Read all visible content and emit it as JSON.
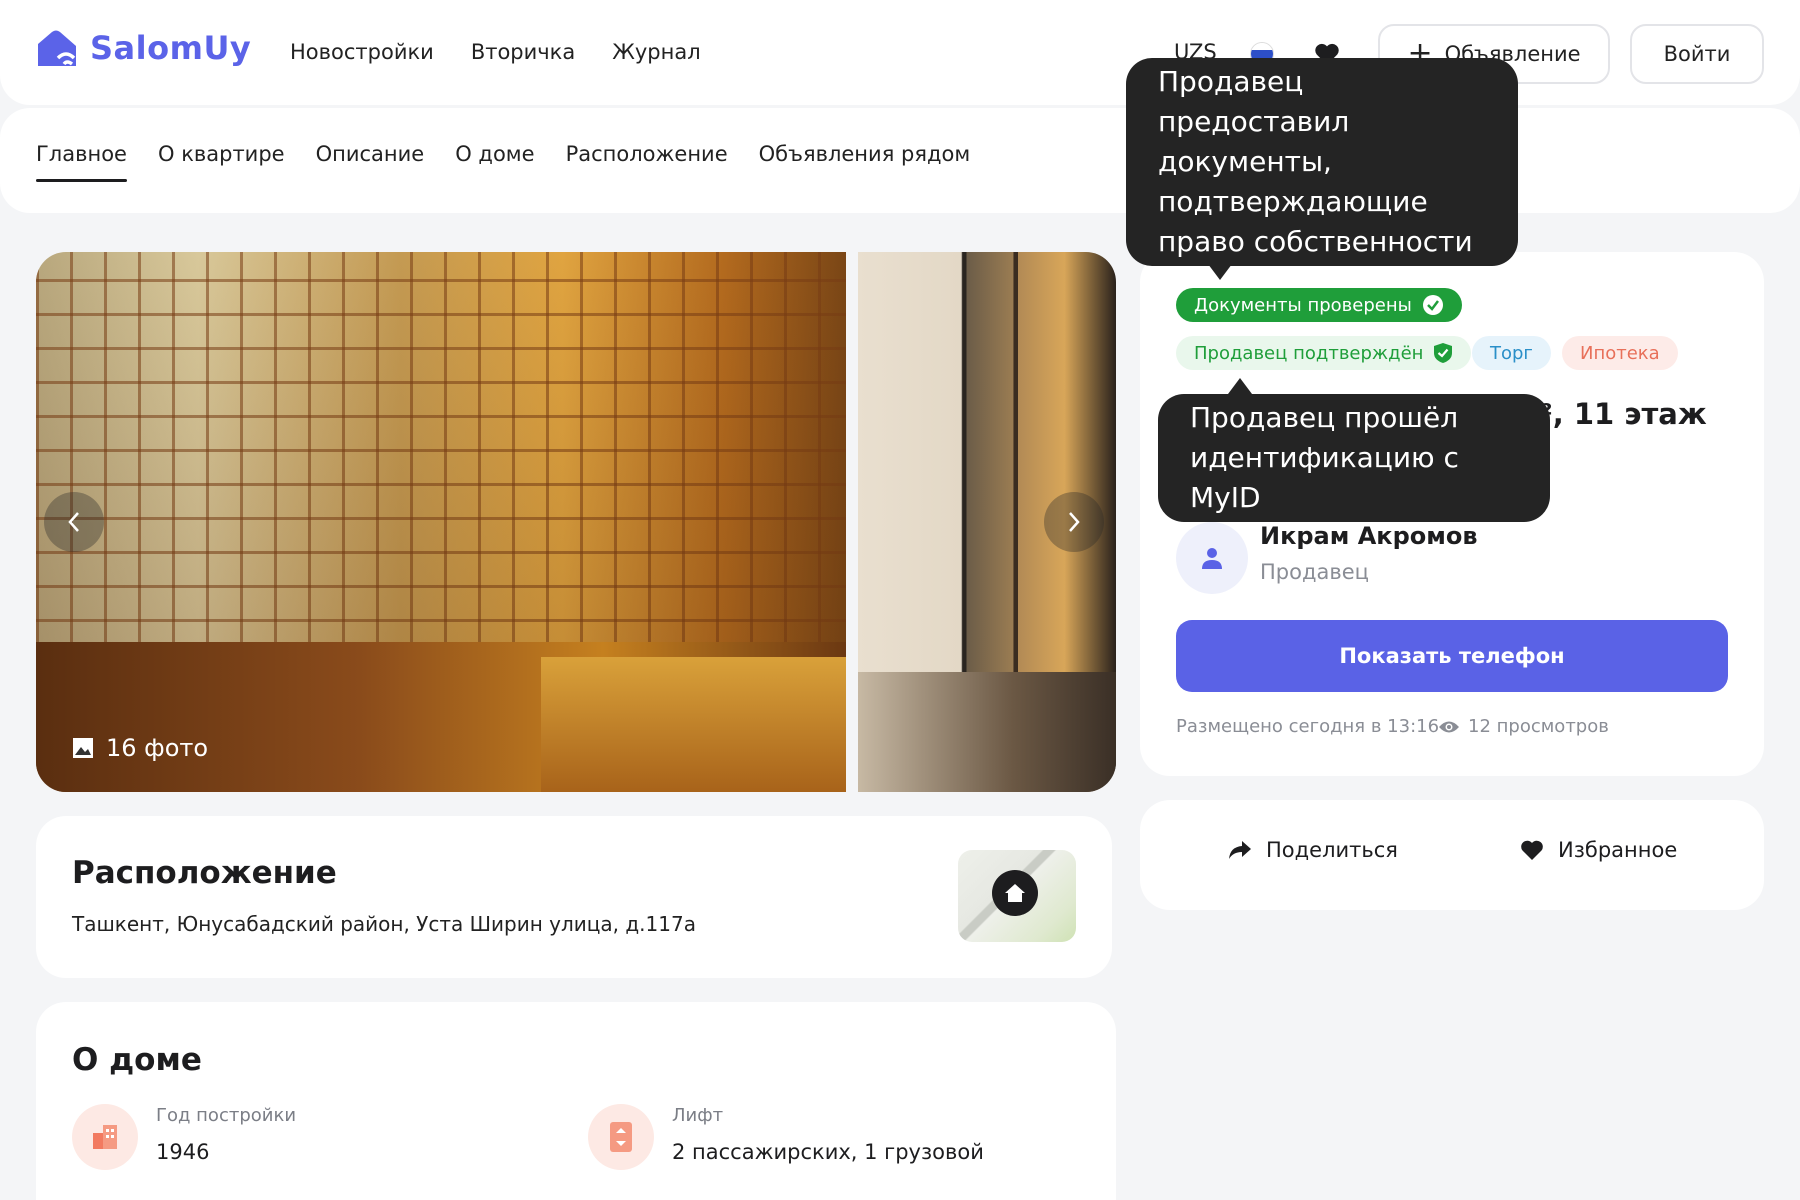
{
  "header": {
    "brand": "SalomUy",
    "nav": [
      "Новостройки",
      "Вторичка",
      "Журнал"
    ],
    "currency": "UZS",
    "post_ad_label": "Объявление",
    "login_label": "Войти"
  },
  "tabs": [
    "Главное",
    "О квартире",
    "Описание",
    "О доме",
    "Расположение",
    "Объявления рядом"
  ],
  "gallery": {
    "photo_count": "16 фото"
  },
  "location": {
    "title": "Расположение",
    "address": "Ташкент, Юнусабадский район, Уста Ширин улица, д.117а"
  },
  "house": {
    "title": "О доме",
    "features": [
      {
        "label": "Год постройки",
        "value": "1946",
        "icon": "building-icon"
      },
      {
        "label": "Лифт",
        "value": "2 пассажирских, 1 грузовой",
        "icon": "elevator-icon"
      }
    ]
  },
  "listing": {
    "badges": {
      "documents": "Документы проверены",
      "seller_verified": "Продавец подтверждён",
      "bargain": "Торг",
      "mortgage": "Ипотека"
    },
    "title_visible": "², 11 этаж",
    "seller_name": "Икрам Акромов",
    "seller_role": "Продавец",
    "show_phone_label": "Показать телефон",
    "posted": "Размещено сегодня в 13:16",
    "views": "12 просмотров"
  },
  "actions": {
    "share": "Поделиться",
    "favorite": "Избранное"
  },
  "tooltips": {
    "documents": "Продавец предоставил документы, подтверждающие право собственности",
    "documents_lines": [
      "Продавец предоставил",
      "документы,",
      "подтверждающие",
      "право собственности"
    ],
    "myid_lines": [
      "Продавец прошёл",
      "идентификацию с MyID"
    ]
  },
  "colors": {
    "brand": "#5b63e8",
    "primary_button": "#5a62e6",
    "badge_green": "#1f9e3a",
    "badge_green_light": "#e9f7ec",
    "badge_blue_light": "#e6f3fb",
    "badge_red_light": "#fdebe8",
    "tooltip_bg": "#242424"
  }
}
